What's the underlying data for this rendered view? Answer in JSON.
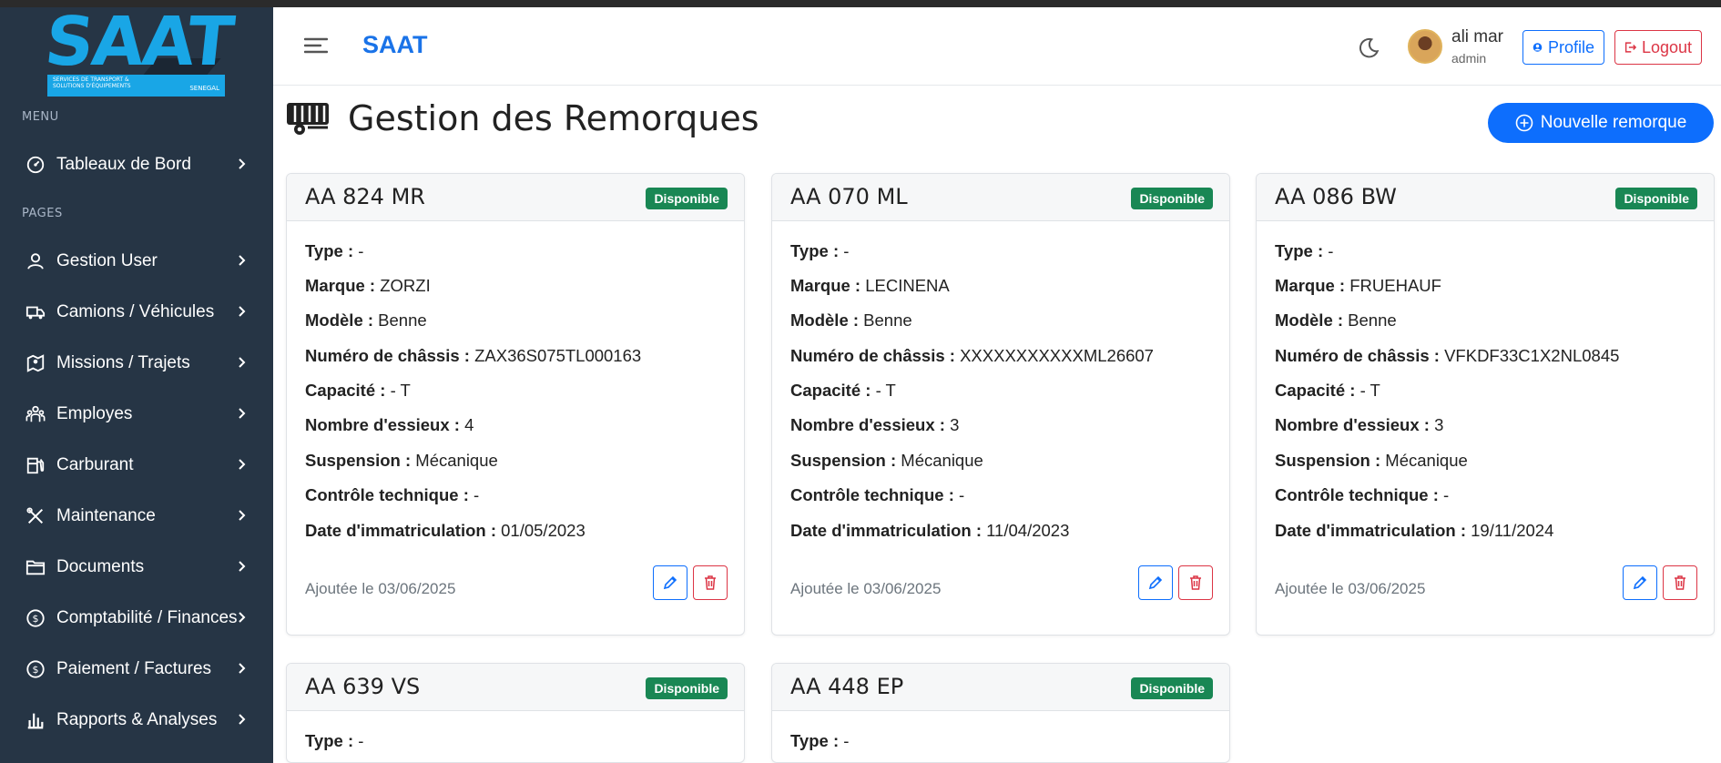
{
  "brand": {
    "logo_text": "SAAT",
    "logo_subtitle": "SERVICES DE TRANSPORT & SOLUTIONS D'ÉQUIPEMENTS",
    "logo_country": "SENEGAL",
    "header_title": "SAAT"
  },
  "sidebar": {
    "menu_label": "MENU",
    "pages_label": "PAGES",
    "items": [
      {
        "label": "Tableaux de Bord",
        "icon": "gauge-icon"
      },
      {
        "label": "Gestion User",
        "icon": "user-icon"
      },
      {
        "label": "Camions / Véhicules",
        "icon": "truck-icon"
      },
      {
        "label": "Missions / Trajets",
        "icon": "map-pin-icon"
      },
      {
        "label": "Employes",
        "icon": "people-icon"
      },
      {
        "label": "Carburant",
        "icon": "fuel-icon"
      },
      {
        "label": "Maintenance",
        "icon": "tools-icon"
      },
      {
        "label": "Documents",
        "icon": "folder-icon"
      },
      {
        "label": "Comptabilité / Finances",
        "icon": "coin-icon"
      },
      {
        "label": "Paiement / Factures",
        "icon": "coin-icon"
      },
      {
        "label": "Rapports & Analyses",
        "icon": "bar-chart-icon"
      }
    ]
  },
  "user": {
    "name": "ali mar",
    "role": "admin",
    "profile_label": "Profile",
    "logout_label": "Logout"
  },
  "page": {
    "title": "Gestion des Remorques",
    "new_button": "Nouvelle remorque"
  },
  "field_labels": {
    "type": "Type :",
    "marque": "Marque :",
    "modele": "Modèle :",
    "chassis": "Numéro de châssis :",
    "capacite": "Capacité :",
    "essieux": "Nombre d'essieux :",
    "suspension": "Suspension :",
    "controle": "Contrôle technique :",
    "immat": "Date d'immatriculation :"
  },
  "cards": [
    {
      "plate": "AA 824 MR",
      "status": "Disponible",
      "type": "-",
      "marque": "ZORZI",
      "modele": "Benne",
      "chassis": "ZAX36S075TL000163",
      "capacite": "- T",
      "essieux": "4",
      "suspension": "Mécanique",
      "controle": "-",
      "immat": "01/05/2023",
      "added": "Ajoutée le 03/06/2025"
    },
    {
      "plate": "AA 070 ML",
      "status": "Disponible",
      "type": "-",
      "marque": "LECINENA",
      "modele": "Benne",
      "chassis": "XXXXXXXXXXXML26607",
      "capacite": "- T",
      "essieux": "3",
      "suspension": "Mécanique",
      "controle": "-",
      "immat": "11/04/2023",
      "added": "Ajoutée le 03/06/2025"
    },
    {
      "plate": "AA 086 BW",
      "status": "Disponible",
      "type": "-",
      "marque": "FRUEHAUF",
      "modele": "Benne",
      "chassis": "VFKDF33C1X2NL0845",
      "capacite": "- T",
      "essieux": "3",
      "suspension": "Mécanique",
      "controle": "-",
      "immat": "19/11/2024",
      "added": "Ajoutée le 03/06/2025"
    },
    {
      "plate": "AA 639 VS",
      "status": "Disponible",
      "type": "-"
    },
    {
      "plate": "AA 448 EP",
      "status": "Disponible",
      "type": "-"
    }
  ],
  "colors": {
    "sidebar_bg": "#263545",
    "primary": "#0d6efd",
    "danger": "#dc3545",
    "success": "#198754",
    "brand_blue": "#19a6e6"
  }
}
